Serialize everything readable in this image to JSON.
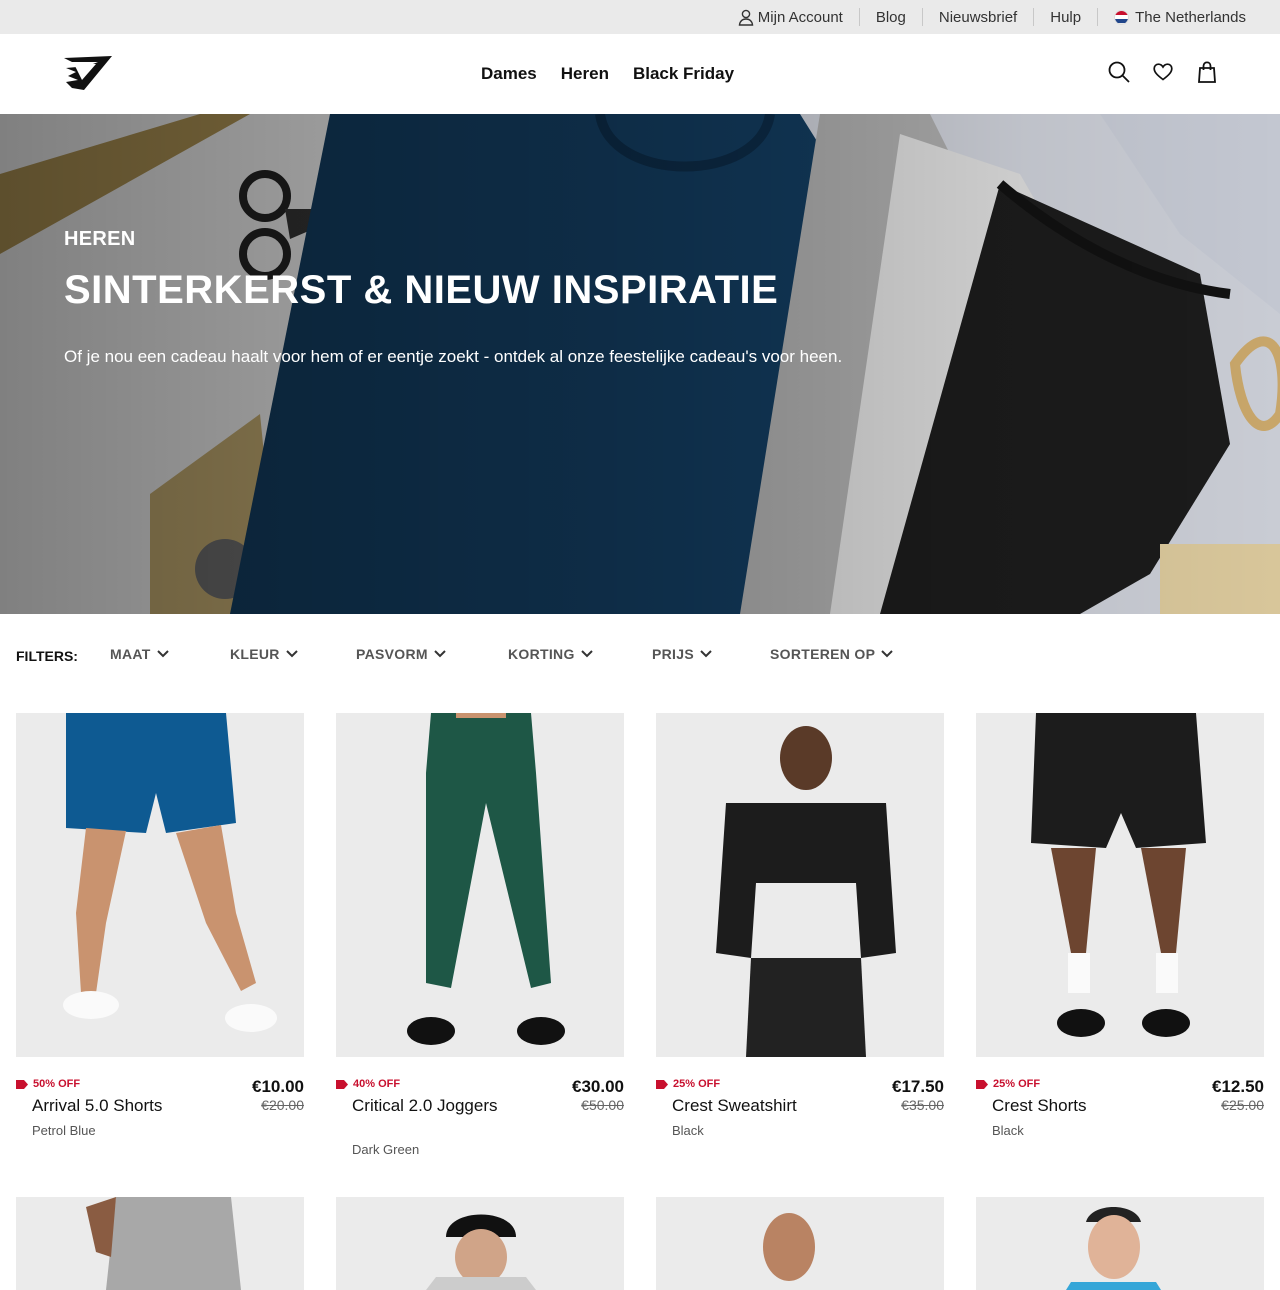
{
  "utility": {
    "account": "Mijn Account",
    "blog": "Blog",
    "newsletter": "Nieuwsbrief",
    "help": "Hulp",
    "region": "The Netherlands"
  },
  "nav": {
    "items": [
      "Dames",
      "Heren",
      "Black Friday"
    ]
  },
  "icons": {
    "logo": "gymshark-logo",
    "search": "search-icon",
    "wishlist": "heart-icon",
    "bag": "bag-icon",
    "account": "user-icon",
    "flag": "netherlands-flag-icon"
  },
  "hero": {
    "eyebrow": "HEREN",
    "title": "SINTERKERST & NIEUW INSPIRATIE",
    "subtitle": "Of je nou een cadeau haalt voor hem of er eentje zoekt - ontdek al onze feestelijke cadeau's voor heen."
  },
  "filters": {
    "label": "FILTERS:",
    "items": [
      "MAAT",
      "KLEUR",
      "PASVORM",
      "KORTING",
      "PRIJS",
      "SORTEREN OP"
    ]
  },
  "products": [
    {
      "discount": "50% OFF",
      "name": "Arrival 5.0 Shorts",
      "color": "Petrol Blue",
      "price": "€10.00",
      "old_price": "€20.00"
    },
    {
      "discount": "40% OFF",
      "name": "Critical 2.0 Joggers",
      "color": "Dark Green",
      "price": "€30.00",
      "old_price": "€50.00"
    },
    {
      "discount": "25% OFF",
      "name": "Crest Sweatshirt",
      "color": "Black",
      "price": "€17.50",
      "old_price": "€35.00"
    },
    {
      "discount": "25% OFF",
      "name": "Crest Shorts",
      "color": "Black",
      "price": "€12.50",
      "old_price": "€25.00"
    }
  ],
  "colors": {
    "accent_sale": "#c8102e",
    "utility_bg": "#eaeaea",
    "product_bg": "#ebebeb"
  }
}
